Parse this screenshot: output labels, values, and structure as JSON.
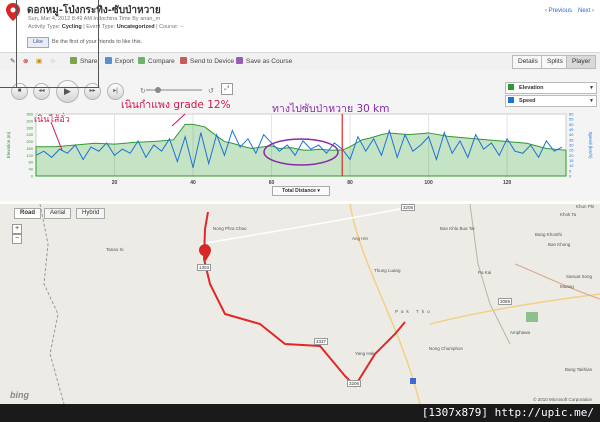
{
  "header": {
    "title": "ดอกหมู-โป่งกระทิง-ซับป่าหวาย",
    "meta": "Sun, Mar 4, 2012 8:49 AM Indochina Time By anan_m",
    "activity_type_label": "Activity Type:",
    "activity_type": "Cycling",
    "event_type_label": "| Event Type:",
    "event_type": "Uncategorized",
    "course_label": "| Course: --",
    "prev": "‹ Previous",
    "next": "Next ›"
  },
  "social": {
    "like_label": "Like",
    "like_text": "Be the first of your friends to like this."
  },
  "toolbar": {
    "share": "Share",
    "export": "Export",
    "compare": "Compare",
    "send": "Send to Device",
    "save_course": "Save as Course",
    "tabs": [
      "Details",
      "Splits",
      "Player"
    ],
    "active_tab": "Player"
  },
  "player": {
    "legend": [
      {
        "label": "Elevation",
        "color": "#2e9a2e"
      },
      {
        "label": "Speed",
        "color": "#1e73d6"
      }
    ],
    "x_axis_select": "Total Distance"
  },
  "chart_data": {
    "type": "area",
    "xlabel": "",
    "x_ticks": [
      20,
      40,
      60,
      80,
      100,
      120
    ],
    "xlim": [
      0,
      135
    ],
    "y_left_ticks": [
      0,
      40,
      80,
      120,
      160,
      200,
      240,
      280,
      320,
      360
    ],
    "y_left_label": "Elevation (m)",
    "y_right_ticks": [
      0,
      5,
      10,
      15,
      20,
      25,
      30,
      35,
      40,
      45,
      50,
      55,
      60
    ],
    "y_right_label": "Speed (km/h)",
    "marker_x": 78,
    "series": [
      {
        "name": "Elevation",
        "x": [
          0,
          5,
          10,
          15,
          20,
          25,
          30,
          35,
          38,
          40,
          43,
          45,
          48,
          50,
          53,
          55,
          58,
          60,
          62,
          65,
          68,
          70,
          72,
          75,
          78,
          80,
          83,
          85,
          88,
          90,
          95,
          100,
          105,
          110,
          115,
          120,
          125,
          130,
          135
        ],
        "y": [
          170,
          170,
          180,
          190,
          185,
          195,
          200,
          210,
          300,
          300,
          285,
          250,
          200,
          190,
          170,
          160,
          170,
          175,
          160,
          165,
          150,
          150,
          155,
          150,
          150,
          170,
          210,
          220,
          240,
          250,
          240,
          250,
          230,
          220,
          210,
          200,
          190,
          160,
          150
        ]
      },
      {
        "name": "Speed",
        "x": [
          0,
          2,
          4,
          6,
          8,
          10,
          12,
          14,
          16,
          18,
          20,
          22,
          24,
          26,
          28,
          30,
          32,
          34,
          36,
          38,
          40,
          42,
          44,
          46,
          48,
          50,
          52,
          54,
          56,
          58,
          60,
          62,
          64,
          66,
          68,
          70,
          72,
          74,
          76,
          78,
          80,
          82,
          84,
          86,
          88,
          90,
          92,
          94,
          96,
          98,
          100,
          102,
          104,
          106,
          108,
          110,
          112,
          114,
          116,
          118,
          120,
          122,
          124,
          126,
          128,
          130,
          132,
          134
        ],
        "y": [
          20,
          24,
          18,
          26,
          22,
          30,
          16,
          28,
          24,
          32,
          20,
          26,
          22,
          34,
          18,
          30,
          24,
          36,
          14,
          38,
          8,
          42,
          12,
          40,
          20,
          44,
          28,
          36,
          22,
          40,
          32,
          24,
          30,
          20,
          34,
          26,
          30,
          22,
          32,
          26,
          16,
          38,
          24,
          36,
          20,
          44,
          18,
          40,
          24,
          30,
          38,
          16,
          42,
          22,
          34,
          18,
          40,
          26,
          32,
          20,
          36,
          24,
          22,
          30,
          18,
          34,
          24,
          28
        ]
      }
    ]
  },
  "annotations": {
    "a1": "เนินไส้อั่ว",
    "a2": "เนินกำแพง grade 12%",
    "a3": "ทางไปซับป่าหวาย 30  km"
  },
  "map": {
    "tabs": [
      "Road",
      "Aerial",
      "Hybrid"
    ],
    "active_tab": "Road",
    "zoom_in": "+",
    "zoom_out": "−",
    "places": [
      "Nong Phra Chao",
      "Tanao Si",
      "Ang Hin",
      "Ban Khlu Bua Tai",
      "Thung Luang",
      "Pa Kai",
      "Ban Khong",
      "Sanuat Song",
      "Muang",
      "Yang Hak",
      "Nong Chumphon",
      "Bang Takhian",
      "Khok Ta",
      "Khun Phi",
      "Bang Khonthi",
      "Pak Tho",
      "Amphawa"
    ],
    "roads": [
      "1303",
      "3208",
      "3337",
      "3206",
      "3089"
    ],
    "copyright": "© 2010 Microsoft Corporation",
    "brand": "bing"
  },
  "footer": "[1307x879] http://upic.me/"
}
